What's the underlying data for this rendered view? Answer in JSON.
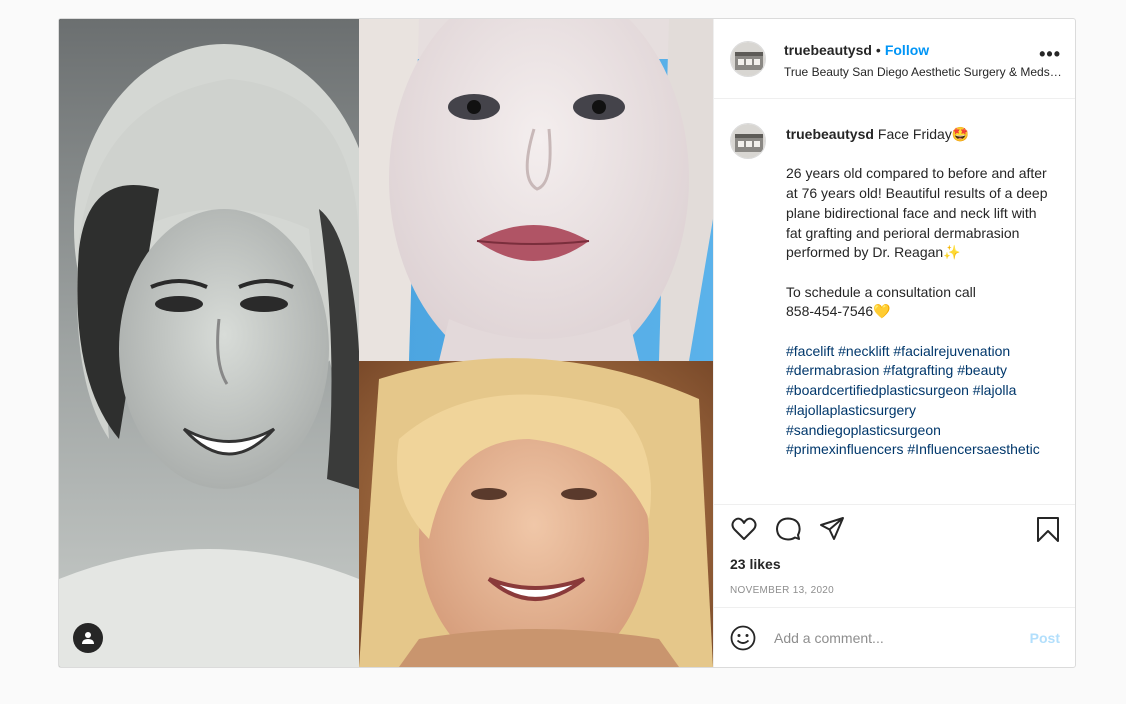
{
  "post": {
    "username": "truebeautysd",
    "separator": "•",
    "follow_label": "Follow",
    "location": "True Beauty San Diego Aesthetic Surgery & Medspa",
    "more_label": "•••"
  },
  "caption": {
    "username": "truebeautysd",
    "title": "Face Friday🤩",
    "paragraph1": "26 years old compared to before and after at 76 years old! Beautiful results of a deep plane bidirectional face and neck lift with fat grafting and perioral dermabrasion performed by Dr. Reagan✨",
    "paragraph2_line1": "To schedule a consultation call",
    "paragraph2_line2": "858-454-7546💛",
    "hashtags": [
      "#facelift",
      "#necklift",
      "#facialrejuvenation",
      "#dermabrasion",
      "#fatgrafting",
      "#beauty",
      "#boardcertifiedplasticsurgeon",
      "#lajolla",
      "#lajollaplasticsurgery",
      "#sandiegoplasticsurgeon",
      "#primexinfluencers",
      "#Influencersaesthetic"
    ]
  },
  "stats": {
    "likes": "23 likes",
    "date": "NOVEMBER 13, 2020"
  },
  "comment": {
    "placeholder": "Add a comment...",
    "post_label": "Post"
  },
  "colors": {
    "accent": "#0095f6",
    "post_disabled": "#b2dffc",
    "hashtag": "#00376b",
    "border": "#dbdbdb",
    "muted": "#8e8e8e"
  }
}
